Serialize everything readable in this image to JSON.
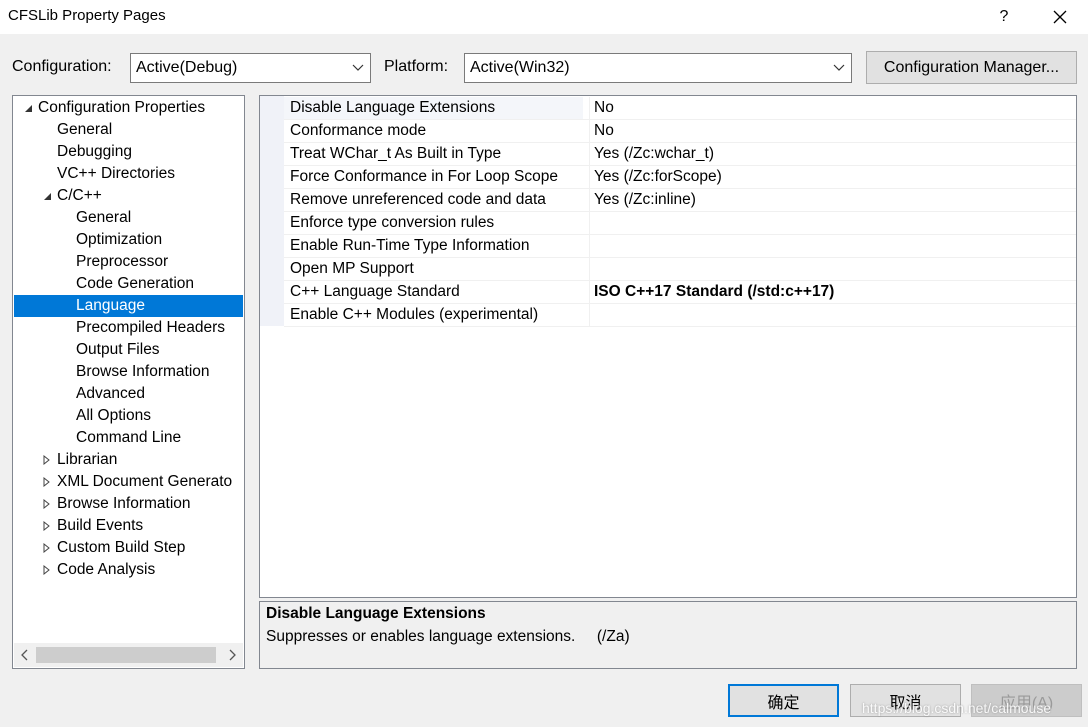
{
  "window": {
    "title": "CFSLib Property Pages",
    "help": "?",
    "close": "✕"
  },
  "config": {
    "configuration_label": "Configuration:",
    "configuration_value": "Active(Debug)",
    "platform_label": "Platform:",
    "platform_value": "Active(Win32)",
    "manager_button": "Configuration Manager..."
  },
  "tree": {
    "items": [
      {
        "label": "Configuration Properties",
        "level": 0,
        "arrow": "expanded"
      },
      {
        "label": "General",
        "level": 1,
        "arrow": "none"
      },
      {
        "label": "Debugging",
        "level": 1,
        "arrow": "none"
      },
      {
        "label": "VC++ Directories",
        "level": 1,
        "arrow": "none"
      },
      {
        "label": "C/C++",
        "level": 1,
        "arrow": "expanded"
      },
      {
        "label": "General",
        "level": 2,
        "arrow": "none"
      },
      {
        "label": "Optimization",
        "level": 2,
        "arrow": "none"
      },
      {
        "label": "Preprocessor",
        "level": 2,
        "arrow": "none"
      },
      {
        "label": "Code Generation",
        "level": 2,
        "arrow": "none"
      },
      {
        "label": "Language",
        "level": 2,
        "arrow": "none",
        "selected": true
      },
      {
        "label": "Precompiled Headers",
        "level": 2,
        "arrow": "none"
      },
      {
        "label": "Output Files",
        "level": 2,
        "arrow": "none"
      },
      {
        "label": "Browse Information",
        "level": 2,
        "arrow": "none"
      },
      {
        "label": "Advanced",
        "level": 2,
        "arrow": "none"
      },
      {
        "label": "All Options",
        "level": 2,
        "arrow": "none"
      },
      {
        "label": "Command Line",
        "level": 2,
        "arrow": "none"
      },
      {
        "label": "Librarian",
        "level": 1,
        "arrow": "collapsed"
      },
      {
        "label": "XML Document Generato",
        "level": 1,
        "arrow": "collapsed"
      },
      {
        "label": "Browse Information",
        "level": 1,
        "arrow": "collapsed"
      },
      {
        "label": "Build Events",
        "level": 1,
        "arrow": "collapsed"
      },
      {
        "label": "Custom Build Step",
        "level": 1,
        "arrow": "collapsed"
      },
      {
        "label": "Code Analysis",
        "level": 1,
        "arrow": "collapsed"
      }
    ]
  },
  "properties": [
    {
      "name": "Disable Language Extensions",
      "value": "No"
    },
    {
      "name": "Conformance mode",
      "value": "No"
    },
    {
      "name": "Treat WChar_t As Built in Type",
      "value": "Yes (/Zc:wchar_t)"
    },
    {
      "name": "Force Conformance in For Loop Scope",
      "value": "Yes (/Zc:forScope)"
    },
    {
      "name": "Remove unreferenced code and data",
      "value": "Yes (/Zc:inline)"
    },
    {
      "name": "Enforce type conversion rules",
      "value": ""
    },
    {
      "name": "Enable Run-Time Type Information",
      "value": ""
    },
    {
      "name": "Open MP Support",
      "value": ""
    },
    {
      "name": "C++ Language Standard",
      "value": "ISO C++17 Standard (/std:c++17)",
      "bold": true
    },
    {
      "name": "Enable C++ Modules (experimental)",
      "value": ""
    }
  ],
  "description": {
    "title": "Disable Language Extensions",
    "body": "Suppresses or enables language extensions.     (/Za)"
  },
  "buttons": {
    "ok": "确定",
    "cancel": "取消",
    "apply": "应用(A)"
  },
  "watermark": "https://blog.csdn.net/calmouse",
  "colors": {
    "selection": "#0078d7",
    "window_bg": "#f0f0f0"
  }
}
